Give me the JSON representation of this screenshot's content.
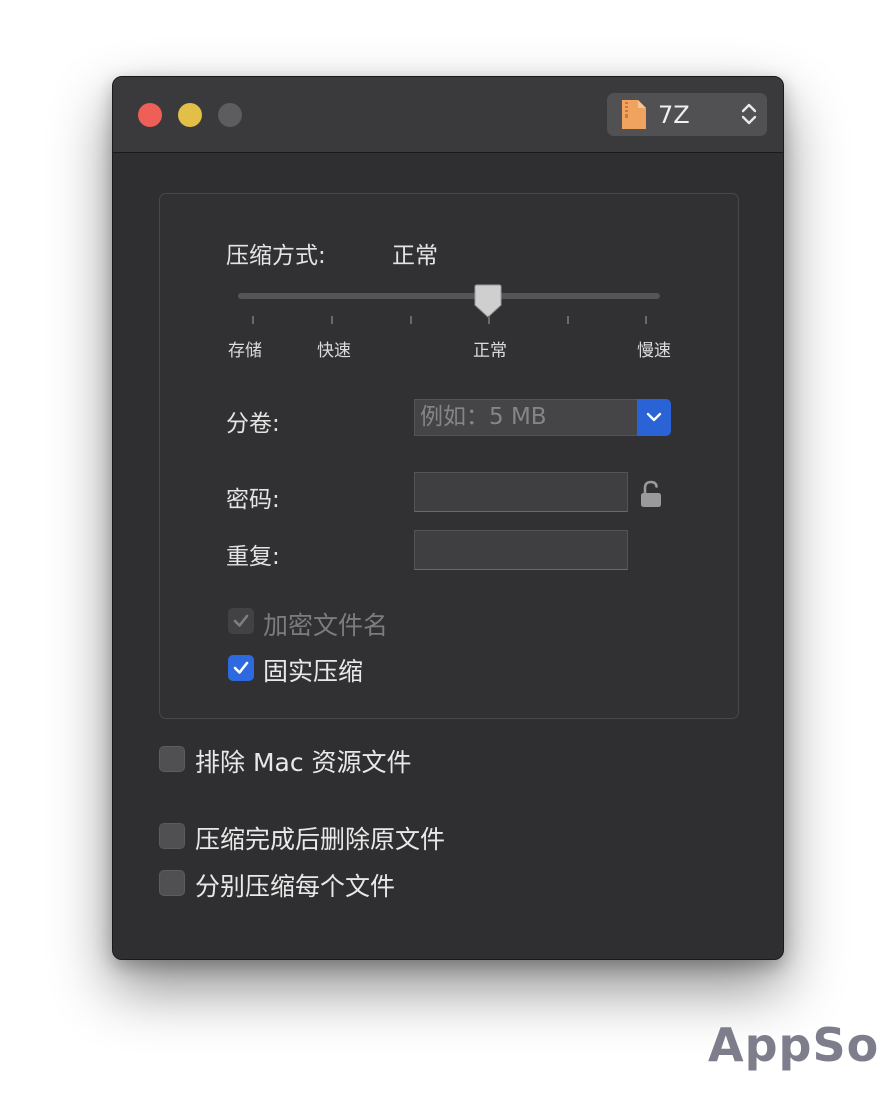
{
  "window": {
    "title_format": {
      "icon": "archive-file-icon",
      "value": "7Z"
    }
  },
  "compression": {
    "method_label": "压缩方式:",
    "method_value": "正常",
    "level_ticks": [
      "存储",
      "快速",
      "正常",
      "慢速"
    ],
    "slider_position_fraction": 0.6,
    "tick_count": 6
  },
  "split": {
    "label": "分卷:",
    "placeholder": "例如：5 MB"
  },
  "password": {
    "label": "密码:",
    "repeat_label": "重复:",
    "lock_icon": "lock-open-icon"
  },
  "options": {
    "encrypt_filenames": {
      "label": "加密文件名",
      "checked": true,
      "enabled": false
    },
    "solid_compression": {
      "label": "固实压缩",
      "checked": true,
      "enabled": true
    }
  },
  "extra": {
    "exclude_mac_resources": {
      "label": "排除 Mac 资源文件",
      "checked": false
    },
    "delete_after": {
      "label": "压缩完成后删除原文件",
      "checked": false
    },
    "compress_separately": {
      "label": "分别压缩每个文件",
      "checked": false
    }
  },
  "watermark": "AppSo",
  "colors": {
    "accent": "#2d6ae0",
    "window_bg": "#2f2f31",
    "close": "#ed5f57",
    "minimize": "#e2bf47"
  }
}
